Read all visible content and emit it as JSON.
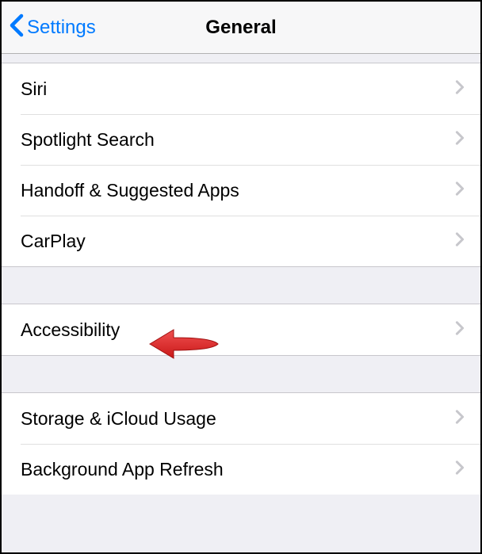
{
  "navbar": {
    "back_label": "Settings",
    "title": "General"
  },
  "groups": [
    {
      "rows": [
        {
          "id": "siri",
          "label": "Siri"
        },
        {
          "id": "spotlight-search",
          "label": "Spotlight Search"
        },
        {
          "id": "handoff-suggested-apps",
          "label": "Handoff & Suggested Apps"
        },
        {
          "id": "carplay",
          "label": "CarPlay"
        }
      ]
    },
    {
      "rows": [
        {
          "id": "accessibility",
          "label": "Accessibility"
        }
      ]
    },
    {
      "rows": [
        {
          "id": "storage-icloud-usage",
          "label": "Storage & iCloud Usage"
        },
        {
          "id": "background-app-refresh",
          "label": "Background App Refresh"
        }
      ]
    }
  ],
  "annotation": {
    "target": "accessibility",
    "color": "#e73c3c"
  }
}
